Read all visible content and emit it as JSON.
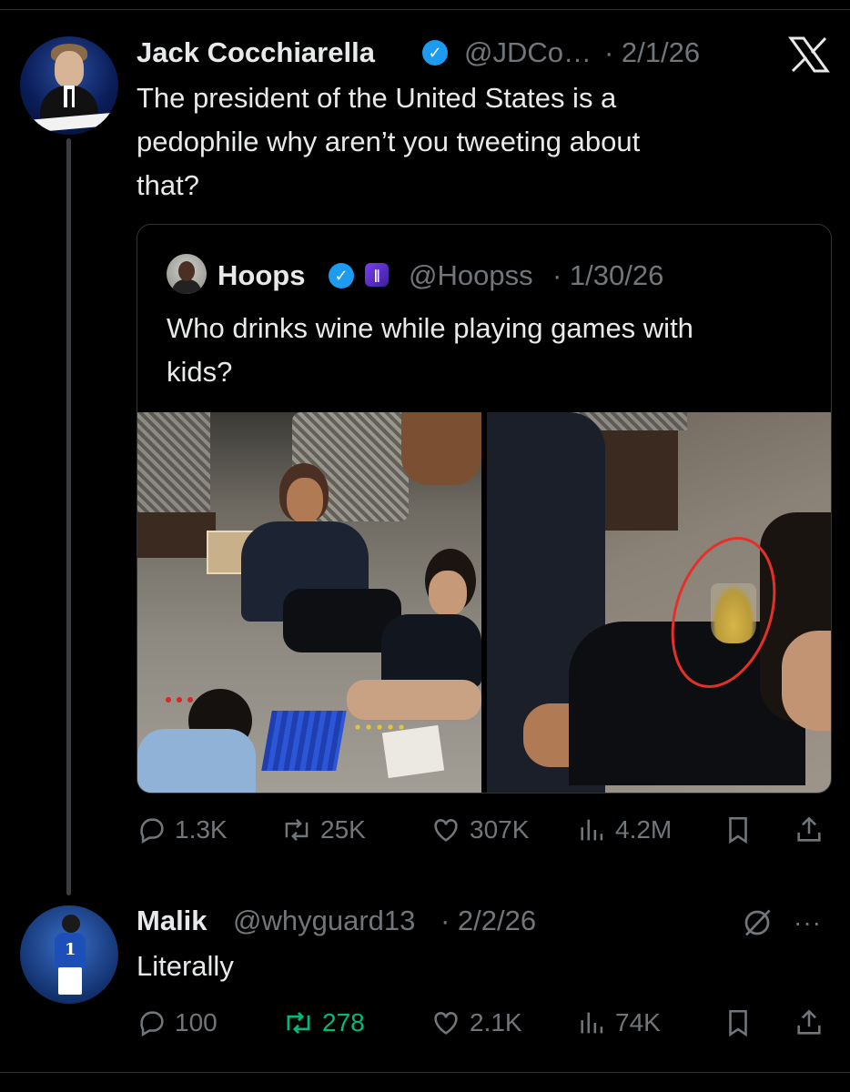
{
  "theme": {
    "background": "#000000",
    "text": "#e7e9ea",
    "muted": "#71767b",
    "accent": "#1d9bf0",
    "repost_active": "#00ba7c",
    "border": "#2f3336"
  },
  "tweet": {
    "author_name": "Jack Cocchiarella",
    "handle": "@JDCo…",
    "date": "· 2/1/26",
    "verified": true,
    "platform_logo": "x-logo",
    "text_lines": [
      "The president of the United States is a",
      "pedophile why aren’t you tweeting about",
      "that?"
    ],
    "quoted": {
      "author_name": "Hoops",
      "verified": true,
      "affiliate_badge": "affiliate-badge-icon",
      "handle": "@Hoopss",
      "date": "· 1/30/26",
      "text_lines": [
        "Who drinks wine while playing games with",
        "kids?"
      ],
      "media": [
        "photo-left",
        "photo-right"
      ]
    },
    "stats": {
      "replies": "1.3K",
      "reposts": "25K",
      "likes": "307K",
      "views": "4.2M"
    }
  },
  "reply": {
    "author_name": "Malik",
    "handle": "@whyguard13",
    "date": "· 2/2/26",
    "text": "Literally",
    "stats": {
      "replies": "100",
      "reposts": "278",
      "likes": "2.1K",
      "views": "74K"
    },
    "reposted_by_viewer": true
  }
}
